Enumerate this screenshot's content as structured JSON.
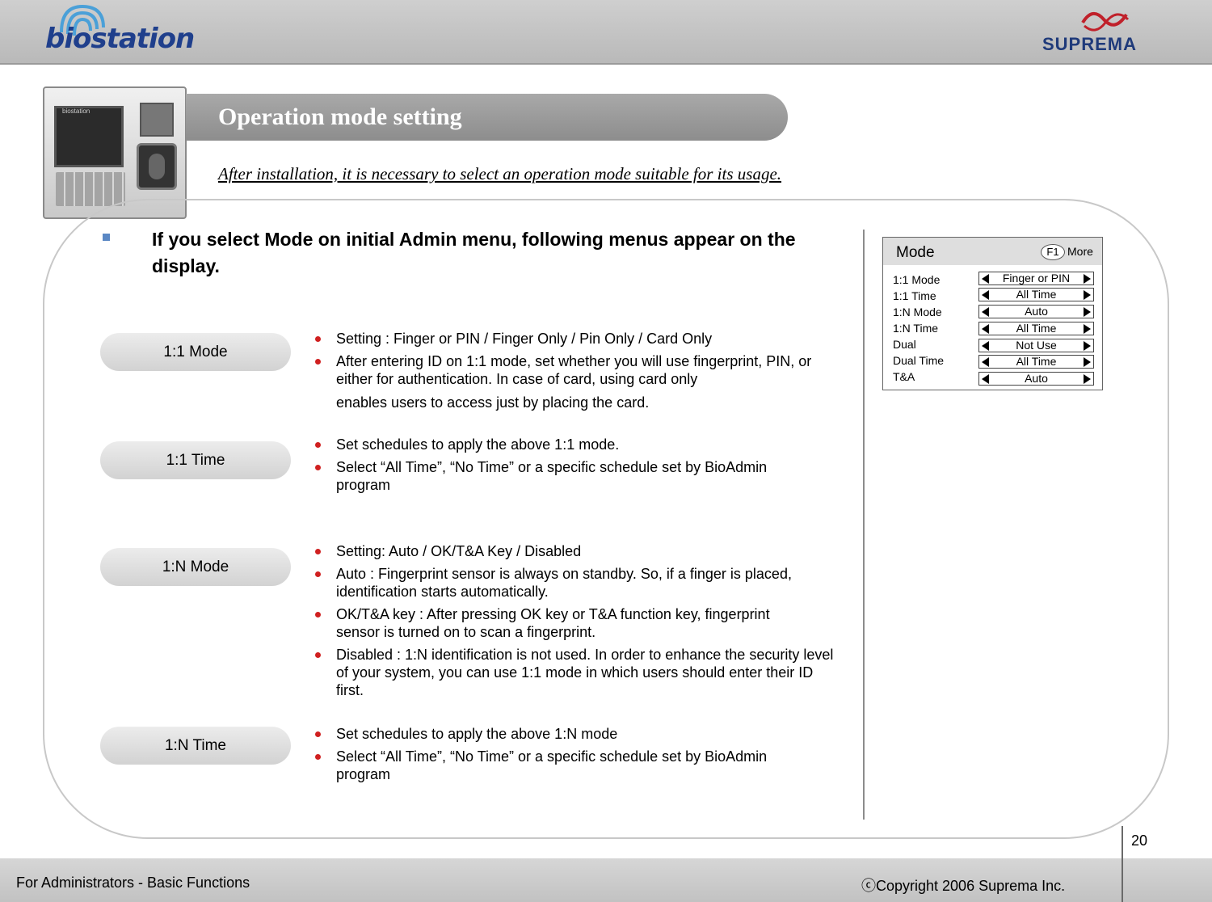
{
  "header": {
    "logo_left": "biostation",
    "logo_right": "SUPREMA"
  },
  "device": {
    "screen_label": "biostation"
  },
  "title": "Operation mode setting",
  "subtitle": "After installation, it is necessary to select  an operation mode suitable for its usage.",
  "heading": "If  you select Mode on initial Admin menu, following menus appear on the display.",
  "sections": [
    {
      "label": "1:1 Mode",
      "items": [
        {
          "text": "Setting : Finger or PIN / Finger Only / Pin Only / Card Only"
        },
        {
          "text": "After entering ID on 1:1 mode, set whether you will use fingerprint, PIN, or either for authentication. In case of card, using card only",
          "extra": "enables users to access just by placing the card."
        }
      ]
    },
    {
      "label": "1:1 Time",
      "items": [
        {
          "text": "Set schedules to apply the above 1:1 mode."
        },
        {
          "text": "Select “All Time”, “No Time” or a specific schedule set by BioAdmin program"
        }
      ]
    },
    {
      "label": "1:N Mode",
      "items": [
        {
          "text": "Setting: Auto / OK/T&A Key / Disabled"
        },
        {
          "text": "Auto : Fingerprint sensor is always on standby. So, if a finger is placed, identification starts automatically."
        },
        {
          "text": "OK/T&A key : After pressing OK key or T&A function key, fingerprint sensor is turned on to scan a fingerprint."
        },
        {
          "text": "Disabled : 1:N identification is not used. In order to enhance the security level of your system, you can use 1:1 mode in which users should enter their ID first."
        }
      ]
    },
    {
      "label": "1:N Time",
      "items": [
        {
          "text": "Set schedules to apply the above 1:N mode"
        },
        {
          "text": "Select “All Time”, “No Time” or a specific schedule set by BioAdmin program"
        }
      ]
    }
  ],
  "lcd": {
    "title": "Mode",
    "f1": "F1",
    "more": "More",
    "labels": [
      "1:1 Mode",
      "1:1 Time",
      "1:N Mode",
      "1:N Time",
      "Dual",
      "Dual Time",
      "T&A"
    ],
    "options": [
      "Finger or PIN",
      "All Time",
      "Auto",
      "All Time",
      "Not Use",
      "All Time",
      "Auto"
    ]
  },
  "footer": {
    "page_number": "20",
    "left": "For Administrators - Basic Functions",
    "right": "ⓒCopyright 2006 Suprema Inc."
  }
}
